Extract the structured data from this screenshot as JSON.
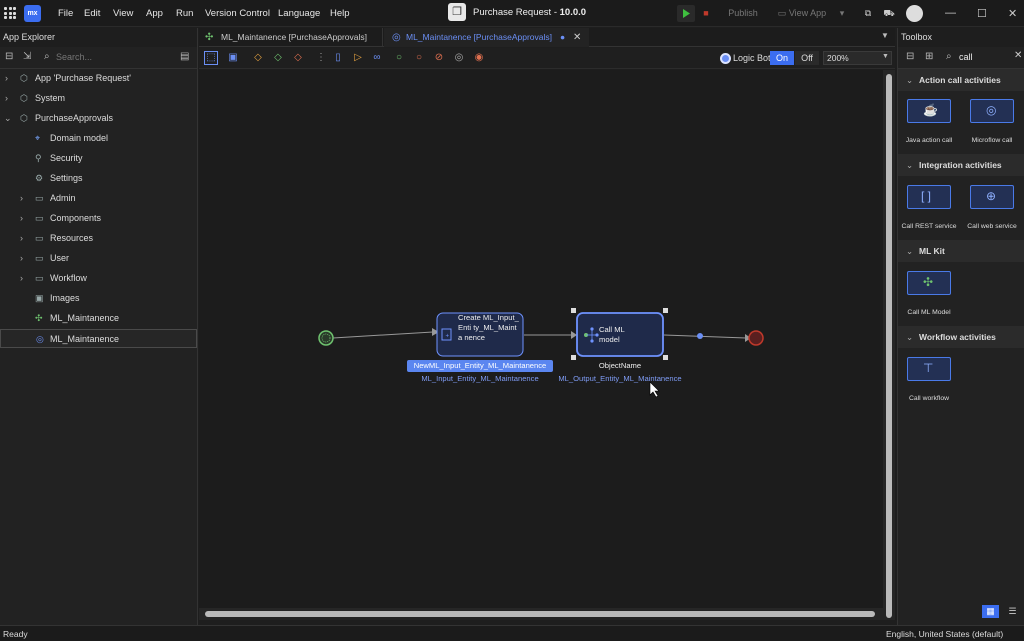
{
  "menu": [
    "File",
    "Edit",
    "View",
    "App",
    "Run",
    "Version Control",
    "Language",
    "Help"
  ],
  "app": {
    "logo": "mx",
    "project_title": "Purchase Request",
    "version": "10.0.0",
    "publish_label": "Publish",
    "view_app_label": "View App"
  },
  "left_panel": {
    "title": "App Explorer",
    "search_placeholder": "Search...",
    "items": [
      {
        "label": "App 'Purchase Request'",
        "icon": "app-icon"
      },
      {
        "label": "System",
        "icon": "module-icon"
      },
      {
        "label": "PurchaseApprovals",
        "icon": "module-icon"
      },
      {
        "label": "Domain model",
        "icon": "domain-model-icon"
      },
      {
        "label": "Security",
        "icon": "security-icon"
      },
      {
        "label": "Settings",
        "icon": "settings-icon"
      },
      {
        "label": "Admin",
        "icon": "folder-icon"
      },
      {
        "label": "Components",
        "icon": "folder-icon"
      },
      {
        "label": "Resources",
        "icon": "folder-icon"
      },
      {
        "label": "User",
        "icon": "folder-icon"
      },
      {
        "label": "Workflow",
        "icon": "folder-icon"
      },
      {
        "label": "Images",
        "icon": "images-icon"
      },
      {
        "label": "ML_Maintanence",
        "icon": "ml-model-icon"
      },
      {
        "label": "ML_Maintanence",
        "icon": "microflow-icon"
      }
    ]
  },
  "tabs": [
    {
      "label": "ML_Maintanence [PurchaseApprovals]"
    },
    {
      "label": "ML_Maintanence [PurchaseApprovals]"
    }
  ],
  "editor_toolbar": {
    "logic_bot_label": "Logic Bot",
    "on_label": "On",
    "off_label": "Off",
    "zoom": "200%"
  },
  "microflow": {
    "create_activity": {
      "text": "Create ML_Input_Enti ty_ML_Mainta nence",
      "variable": "NewML_Input_Entity_ML_Maintanence",
      "entity": "ML_Input_Entity_ML_Maintanence"
    },
    "call_activity": {
      "text": "Call ML model",
      "variable": "ObjectName",
      "entity": "ML_Output_Entity_ML_Maintanence"
    }
  },
  "toolbox": {
    "title": "Toolbox",
    "search_value": "call",
    "sections": [
      {
        "title": "Action call activities",
        "tools": [
          {
            "label": "Java action call",
            "icon": "java-cup-icon"
          },
          {
            "label": "Microflow call",
            "icon": "microflow-call-icon"
          }
        ]
      },
      {
        "title": "Integration activities",
        "tools": [
          {
            "label": "Call REST service",
            "icon": "rest-icon"
          },
          {
            "label": "Call web service",
            "icon": "globe-icon"
          }
        ]
      },
      {
        "title": "ML Kit",
        "tools": [
          {
            "label": "Call ML Model",
            "icon": "ml-model-icon"
          }
        ]
      },
      {
        "title": "Workflow activities",
        "tools": [
          {
            "label": "Call workflow",
            "icon": "workflow-icon"
          }
        ]
      }
    ]
  },
  "status": {
    "left": "Ready",
    "language": "English, United States (default)"
  },
  "colors": {
    "accent": "#3b6df0",
    "activity_border": "#6f93ff",
    "selected_blue": "#6b8ff5",
    "start_event": "#6fc36f",
    "end_event": "#c0392b"
  }
}
